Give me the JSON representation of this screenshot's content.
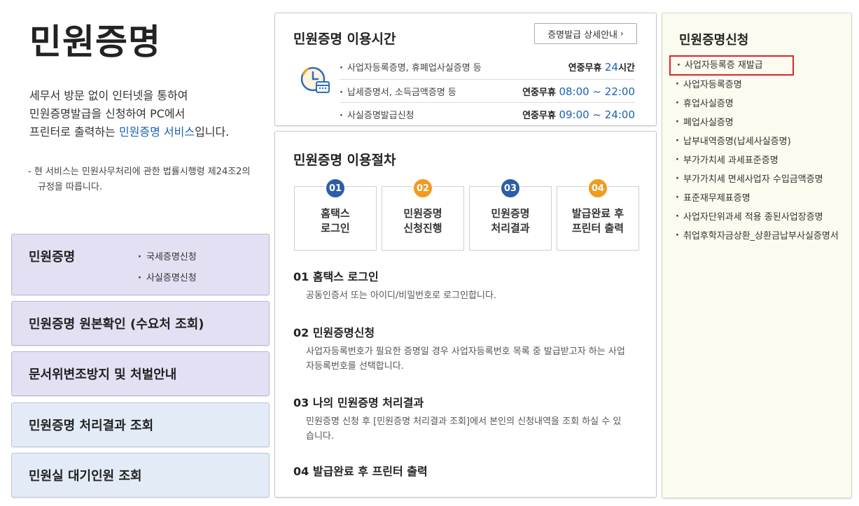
{
  "left": {
    "title": "민원증명",
    "intro_line1": "세무서 방문 없이 인터넷을 통하여",
    "intro_line2": "민원증명발급을 신청하여 PC에서",
    "intro_line3_pre": "프린터로 출력하는 ",
    "intro_line3_hl": "민원증명 서비스",
    "intro_line3_post": "입니다.",
    "note": "- 현 서비스는 민원사무처리에 관한 법률시행령 제24조2의 규정을 따릅니다.",
    "menu": [
      {
        "label": "민원증명",
        "subs": [
          "국세증명신청",
          "사실증명신청"
        ]
      },
      {
        "label": "민원증명 원본확인 (수요처 조회)"
      },
      {
        "label": "문서위변조방지 및 처벌안내"
      },
      {
        "label": "민원증명 처리결과 조회"
      },
      {
        "label": "민원실 대기인원 조회"
      }
    ]
  },
  "hours": {
    "title": "민원증명 이용시간",
    "detail_button": "증명발급 상세안내",
    "rows": [
      {
        "name": "사업자등록증명, 휴폐업사실증명 등",
        "prefix": "연중무휴 ",
        "time": "24",
        "suffix": "시간"
      },
      {
        "name": "납세증명서, 소득금액증명 등",
        "prefix": "연중무휴 ",
        "time": "08:00 ~ 22:00",
        "suffix": ""
      },
      {
        "name": "사실증명발급신청",
        "prefix": "연중무휴 ",
        "time": "09:00 ~ 24:00",
        "suffix": ""
      }
    ]
  },
  "procedure": {
    "title": "민원증명 이용절차",
    "steps": [
      {
        "num": "01",
        "label": "홈택스\n로그인",
        "color": "blue"
      },
      {
        "num": "02",
        "label": "민원증명\n신청진행",
        "color": "orange"
      },
      {
        "num": "03",
        "label": "민원증명\n처리결과",
        "color": "blue"
      },
      {
        "num": "04",
        "label": "발급완료 후\n프린터 출력",
        "color": "orange"
      }
    ],
    "sections": [
      {
        "title": "01 홈택스 로그인",
        "desc": "공동인증서 또는 아이디/비밀번호로 로그인합니다."
      },
      {
        "title": "02 민원증명신청",
        "desc": "사업자등록번호가 필요한 증명일 경우 사업자등록번호 목록 중 발급받고자 하는 사업자등록번호를 선택합니다."
      },
      {
        "title": "03 나의 민원증명 처리결과",
        "desc": "민원증명 신청 후 [민원증명 처리결과 조회]에서 본인의 신청내역을 조회 하실 수 있습니다."
      },
      {
        "title": "04 발급완료 후 프린터 출력",
        "desc": ""
      }
    ]
  },
  "apply": {
    "title": "민원증명신청",
    "items": [
      "사업자등록증 재발급",
      "사업자등록증명",
      "휴업사실증명",
      "폐업사실증명",
      "납부내역증명(납세사실증명)",
      "부가가치세 과세표준증명",
      "부가가치세 면세사업자 수입금액증명",
      "표준재무제표증명",
      "사업자단위과세 적용 종된사업장증명",
      "취업후학자금상환_상환금납부사실증명서"
    ]
  },
  "colors": {
    "accent_blue": "#1b62b3",
    "step_blue": "#2c5ea8",
    "step_orange": "#f39a21",
    "highlight_red": "#e0242a"
  }
}
